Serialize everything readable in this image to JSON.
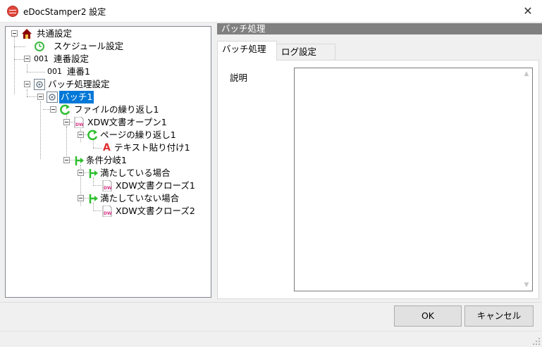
{
  "window": {
    "title": "eDocStamper2 設定",
    "close_glyph": "✕"
  },
  "tree": {
    "nodes": [
      {
        "label": "共通設定",
        "icon": "house-icon"
      },
      {
        "label": "スケジュール設定",
        "icon": "clock-icon"
      },
      {
        "label": "連番設定",
        "icon_text": "001"
      },
      {
        "label": "連番1",
        "icon_text": "001"
      },
      {
        "label": "バッチ処理設定",
        "icon": "batch-gear-icon"
      },
      {
        "label": "バッチ1",
        "icon": "batch-gear-icon",
        "selected": true
      },
      {
        "label": "ファイルの繰り返し1",
        "icon": "loop-arrow-icon"
      },
      {
        "label": "XDW文書オープン1",
        "icon": "xdw-document-icon",
        "icon_text": "DW"
      },
      {
        "label": "ページの繰り返し1",
        "icon": "loop-arrow-icon"
      },
      {
        "label": "テキスト貼り付け1",
        "icon": "text-a-icon",
        "icon_text": "A"
      },
      {
        "label": "条件分岐1",
        "icon": "branch-arrow-icon"
      },
      {
        "label": "満たしている場合",
        "icon": "branch-arrow-icon"
      },
      {
        "label": "XDW文書クローズ1",
        "icon": "xdw-document-icon",
        "icon_text": "DW"
      },
      {
        "label": "満たしていない場合",
        "icon": "branch-arrow-icon"
      },
      {
        "label": "XDW文書クローズ2",
        "icon": "xdw-document-icon",
        "icon_text": "DW"
      }
    ]
  },
  "right": {
    "header": "バッチ処理",
    "tabs": [
      {
        "label": "バッチ処理",
        "active": true
      },
      {
        "label": "ログ設定",
        "active": false
      }
    ],
    "description_label": "説明",
    "description_value": ""
  },
  "buttons": {
    "ok": "OK",
    "cancel": "キャンセル"
  },
  "colors": {
    "selection": "#0078d7",
    "header_bar": "#808080",
    "loop_green": "#2fbf2f",
    "xdw_pink": "#d63384"
  }
}
